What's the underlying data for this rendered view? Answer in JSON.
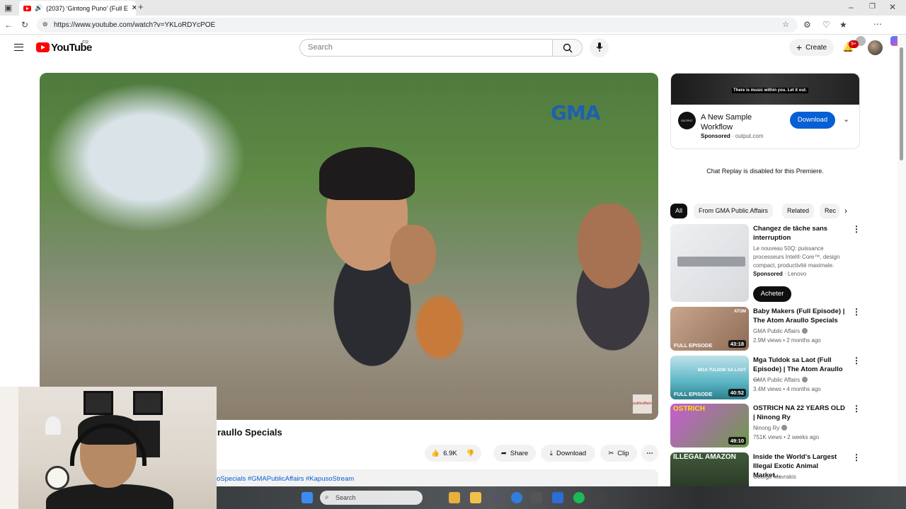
{
  "browser": {
    "tab_title": "(2037) 'Gintong Puno' (Full E",
    "url": "https://www.youtube.com/watch?v=YKLoRDYcPOE"
  },
  "yt_header": {
    "logo_text": "YouTube",
    "country": "FR",
    "search_placeholder": "Search",
    "create_label": "Create",
    "notif_count": "9+"
  },
  "video": {
    "watermark": "GMA",
    "corner_logo": "publicaffairs",
    "title_visible": "raullo Specials",
    "like_count": "6.9K",
    "share_label": "Share",
    "download_label": "Download",
    "clip_label": "Clip",
    "description_tags": "oSpecials #GMAPublicAffairs #KapusoStream"
  },
  "ad": {
    "banner_text": "There is music within you. Let it out.",
    "logo_text": "OUTPUT",
    "title": "A New Sample Workflow",
    "sponsored": "Sponsored",
    "domain": "output.com",
    "download_label": "Download"
  },
  "chat_replay": "Chat Replay is disabled for this Premiere.",
  "chips": [
    "All",
    "From GMA Public Affairs",
    "Related",
    "Rec"
  ],
  "sponsored_rec": {
    "title": "Changez de tâche sans interruption",
    "body": "Le nouveau 50Q: puissance processeurs Intel® Core™, design compact, productivité maximale.",
    "sponsored": "Sponsored",
    "brand": "Lenovo",
    "cta": "Acheter"
  },
  "recommendations": [
    {
      "title": "Baby Makers (Full Episode) | The Atom Araullo Specials",
      "channel": "GMA Public Affairs",
      "meta": "2.9M views • 2 months ago",
      "duration": "43:18",
      "badge": "FULL EPISODE"
    },
    {
      "title": "Mga Tuldok sa Laot (Full Episode) | The Atom Araullo ...",
      "channel": "GMA Public Affairs",
      "meta": "3.4M views • 4 months ago",
      "duration": "40:52",
      "badge": "FULL EPISODE"
    },
    {
      "title": "OSTRICH NA 22 YEARS OLD | Ninong Ry",
      "channel": "Ninong Ry",
      "meta": "751K views • 2 weeks ago",
      "duration": "49:10",
      "badge": ""
    },
    {
      "title": "Inside the World's Largest Illegal Exotic Animal Market... ",
      "channel": "George Mavrakis",
      "meta": "",
      "duration": "",
      "badge": ""
    }
  ],
  "thumb_texts": [
    "ATOM",
    "MGA TULDOK SA LAOT",
    "OSTRICH",
    "ILLEGAL AMAZON"
  ],
  "taskbar": {
    "search_label": "Search"
  },
  "colors": {
    "accent": "#065fd4",
    "yt_red": "#ff0000"
  }
}
